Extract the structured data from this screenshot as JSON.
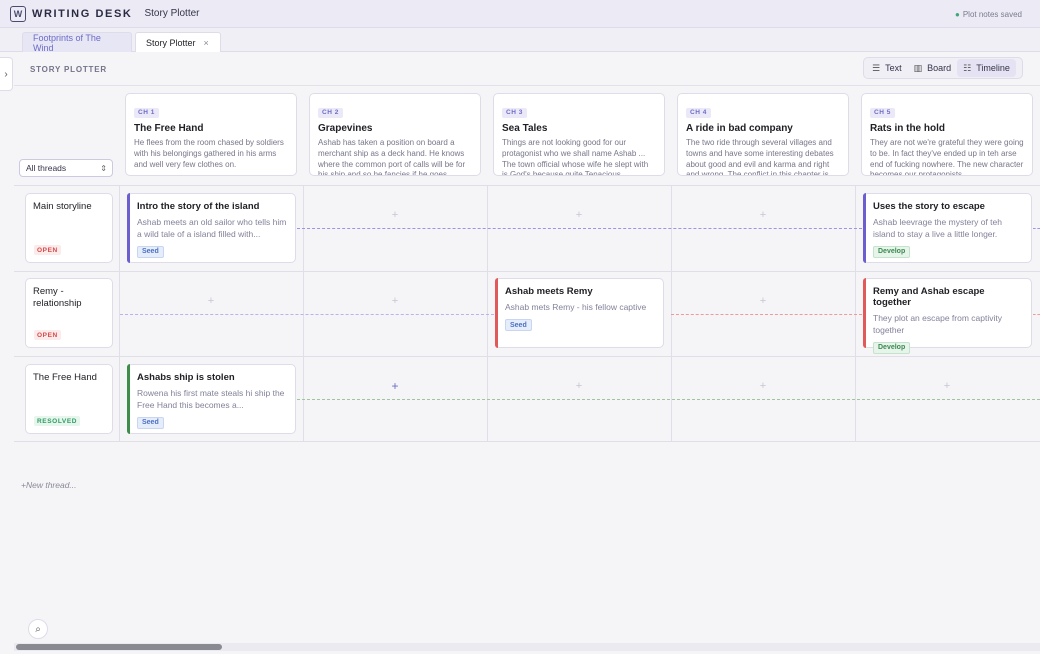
{
  "app": {
    "brand": "WRITING DESK",
    "title": "Story Plotter",
    "logo_glyph": "W",
    "saved_status": "Plot notes saved"
  },
  "tabs": [
    {
      "label": "Footprints of The Wind"
    },
    {
      "label": "Story Plotter",
      "close": "×"
    }
  ],
  "section": {
    "title": "STORY PLOTTER",
    "views": [
      {
        "label": "Text",
        "icon": "lines-icon"
      },
      {
        "label": "Board",
        "icon": "board-icon"
      },
      {
        "label": "Timeline",
        "icon": "timeline-icon"
      }
    ],
    "active_view": "Timeline"
  },
  "filter": {
    "selected": "All threads"
  },
  "chapters": [
    {
      "badge": "CH 1",
      "title": "The Free Hand",
      "desc": "He flees from the room chased by soldiers with his belongings gathered in his arms and well very few clothes on."
    },
    {
      "badge": "CH 2",
      "title": "Grapevines",
      "desc": "Ashab has taken a position on board a merchant ship as a deck hand. He knows where the common port of calls will be for his ship and so he fancies if he goes"
    },
    {
      "badge": "CH 3",
      "title": "Sea Tales",
      "desc": "Things are not looking good for our protagonist who we shall name Ashab ... The town official whose wife he slept with is God's because quite Tenacious"
    },
    {
      "badge": "CH 4",
      "title": "A ride in bad company",
      "desc": "The two ride through several villages and towns and have some interesting debates about good and evil and karma and right and wrong. The conflict in this chapter is"
    },
    {
      "badge": "CH 5",
      "title": "Rats in the hold",
      "desc": "They are not we're grateful they were going to be. In fact they've ended up in teh arse end of fucking nowhere. The new character becomes our protagonists"
    }
  ],
  "threads": [
    {
      "name": "Main storyline",
      "status": "OPEN",
      "color": "#7b6fd6"
    },
    {
      "name": "Remy - relationship",
      "status": "OPEN",
      "color": "#e06666"
    },
    {
      "name": "The Free Hand",
      "status": "RESOLVED",
      "color": "#5a9a5a"
    }
  ],
  "beats": [
    {
      "title": "Intro the story of the island",
      "desc": "Ashab meets an old sailor who tells him a wild tale of a island filled with...",
      "tag": "Seed",
      "accent": "#6b5fd0"
    },
    {
      "title": "Uses the story to escape",
      "desc": "Ashab leevrage the mystery of teh island to stay a live a little longer.",
      "tag": "Develop",
      "accent": "#6b5fd0"
    },
    {
      "title": "Ashab meets Remy",
      "desc": "Ashab mets Remy - his fellow captive",
      "tag": "Seed",
      "accent": "#e05a5a"
    },
    {
      "title": "Remy and Ashab escape together",
      "desc": "They plot an escape from captivity together",
      "tag": "Develop",
      "accent": "#e05a5a"
    },
    {
      "title": "Ashabs ship is stolen",
      "desc": "Rowena his first mate steals hi ship the Free Hand this becomes a...",
      "tag": "Seed",
      "accent": "#3e8e4a"
    }
  ],
  "new_thread_label": "New thread...",
  "new_thread_plus": "+",
  "plus_glyph": "+",
  "zoom_icon": "search-icon"
}
